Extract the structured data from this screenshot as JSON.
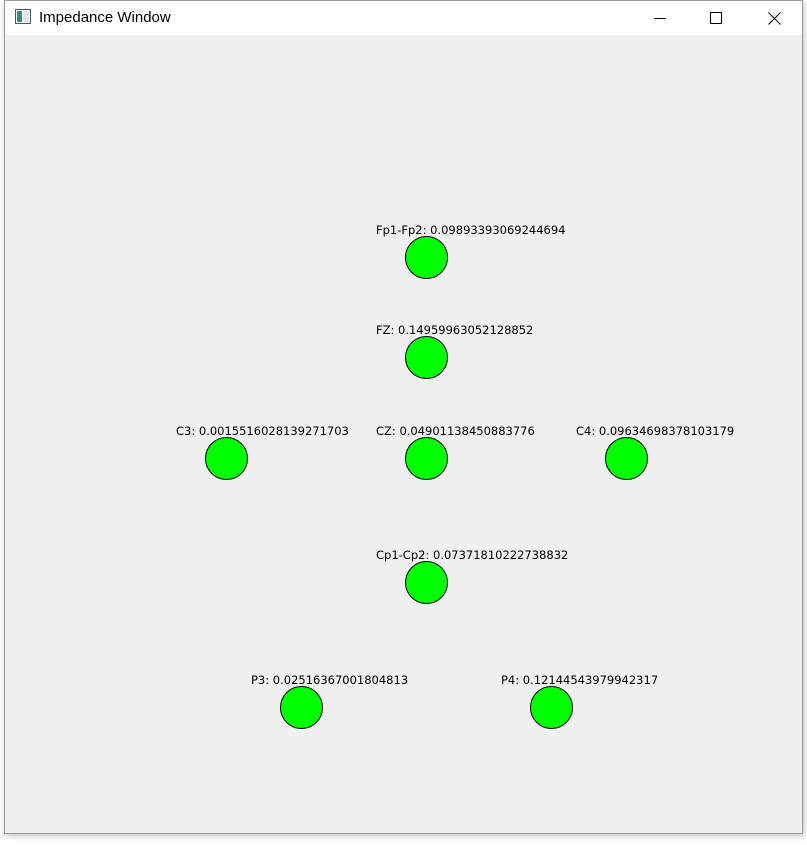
{
  "window": {
    "title": "Impedance Window",
    "controls": {
      "minimize": "minimize-icon",
      "maximize": "maximize-icon",
      "close": "close-icon"
    }
  },
  "colors": {
    "electrode_fill": "#00ff00",
    "background": "#f0f0f0"
  },
  "electrodes": [
    {
      "id": "fp1-fp2",
      "label": "Fp1-Fp2: 0.09893393069244694"
    },
    {
      "id": "fz",
      "label": "FZ: 0.14959963052128852"
    },
    {
      "id": "c3",
      "label": "C3: 0.0015516028139271703"
    },
    {
      "id": "cz",
      "label": "CZ: 0.04901138450883776"
    },
    {
      "id": "c4",
      "label": "C4: 0.09634698378103179"
    },
    {
      "id": "cp1-cp2",
      "label": "Cp1-Cp2: 0.07371810222738832"
    },
    {
      "id": "p3",
      "label": "P3: 0.02516367001804813"
    },
    {
      "id": "p4",
      "label": "P4: 0.12144543979942317"
    }
  ]
}
